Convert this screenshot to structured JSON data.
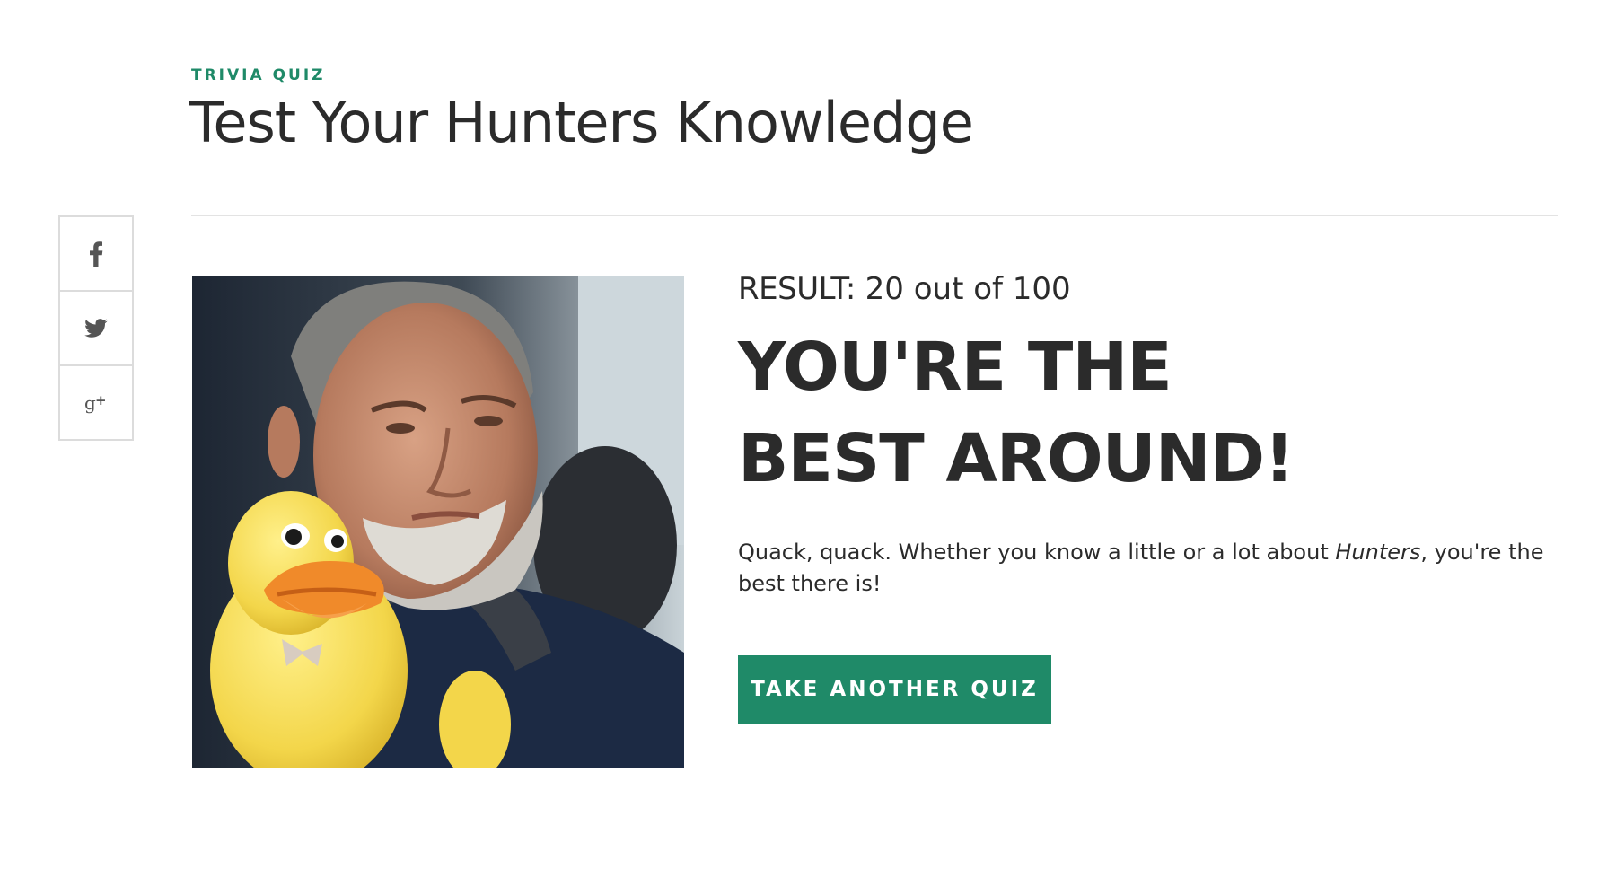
{
  "header": {
    "eyebrow": "TRIVIA QUIZ",
    "title": "Test Your Hunters Knowledge"
  },
  "share": {
    "buttons": [
      {
        "icon": "facebook-icon"
      },
      {
        "icon": "twitter-icon"
      },
      {
        "icon": "google-plus-icon"
      }
    ]
  },
  "result": {
    "score_label": "RESULT:",
    "score_value": "20 out of 100",
    "heading": "YOU'RE THE BEST AROUND!",
    "description_before": "Quack, quack. Whether you know a little or a lot about ",
    "description_emphasis": "Hunters",
    "description_after": ", you're the best there is!",
    "cta_label": "TAKE ANOTHER QUIZ"
  },
  "colors": {
    "accent": "#1f8a68",
    "text": "#2b2b2b",
    "divider": "#e3e3e3"
  }
}
